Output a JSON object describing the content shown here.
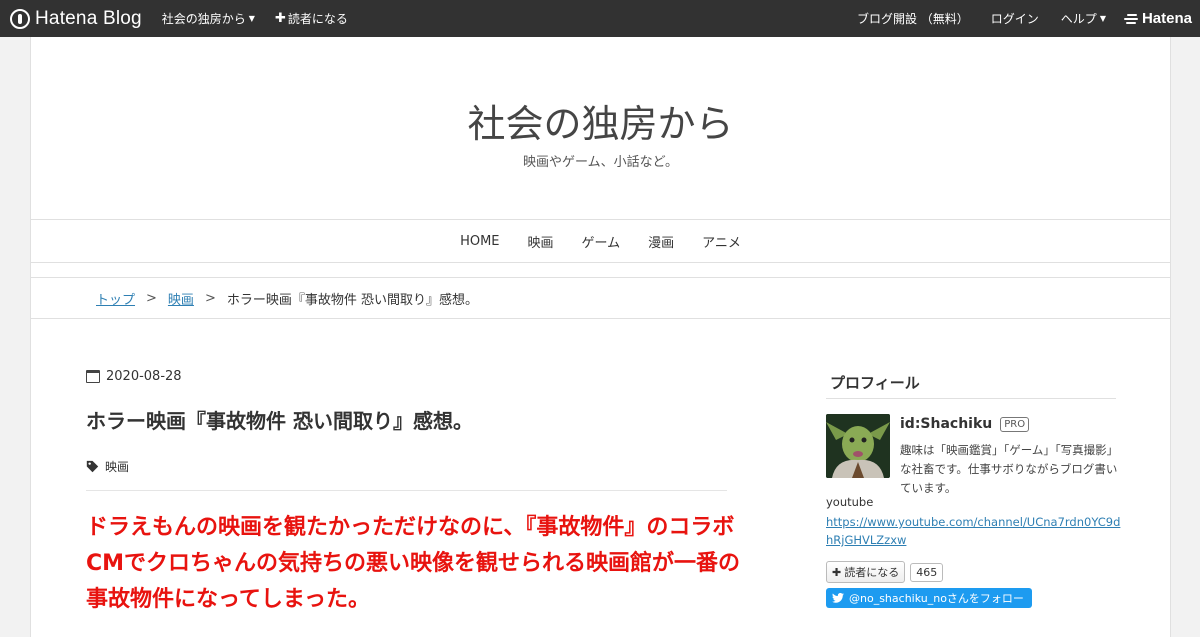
{
  "topbar": {
    "brand": "Hatena Blog",
    "blog_menu": "社会の独房から",
    "subscribe": "読者になる",
    "open_blog": "ブログ開設 （無料）",
    "login": "ログイン",
    "help": "ヘルプ",
    "hatena": "Hatena"
  },
  "header": {
    "title": "社会の独房から",
    "description": "映画やゲーム、小話など。"
  },
  "global_nav": {
    "items": [
      "HOME",
      "映画",
      "ゲーム",
      "漫画",
      "アニメ"
    ]
  },
  "breadcrumb": {
    "top": "トップ",
    "category": "映画",
    "current": "ホラー映画『事故物件 恐い間取り』感想。",
    "separator": ">"
  },
  "entry": {
    "date": "2020-08-28",
    "title": "ホラー映画『事故物件 恐い間取り』感想。",
    "category": "映画",
    "lead": "ドラえもんの映画を観たかっただけなのに、『事故物件』のコラボCMでクロちゃんの気持ちの悪い映像を観せられる映画館が一番の事故物件になってしまった。",
    "lead_color": "#e8130f"
  },
  "sidebar": {
    "title": "プロフィール",
    "id": "id:Shachiku",
    "badge": "PRO",
    "description": "趣味は「映画鑑賞」「ゲーム」「写真撮影」な社畜です。仕事サボりながらブログ書いています。",
    "youtube_label": "youtube",
    "youtube_url": "https://www.youtube.com/channel/UCna7rdn0YC9dhRjGHVLZzxw",
    "subscribe_label": "読者になる",
    "subscriber_count": "465",
    "twitter_follow": "@no_shachiku_noさんをフォロー",
    "twitter_color": "#1d9bf0"
  },
  "icons": {
    "date": "calendar-icon",
    "category": "tag-icon",
    "twitter": "twitter-bird-icon"
  }
}
